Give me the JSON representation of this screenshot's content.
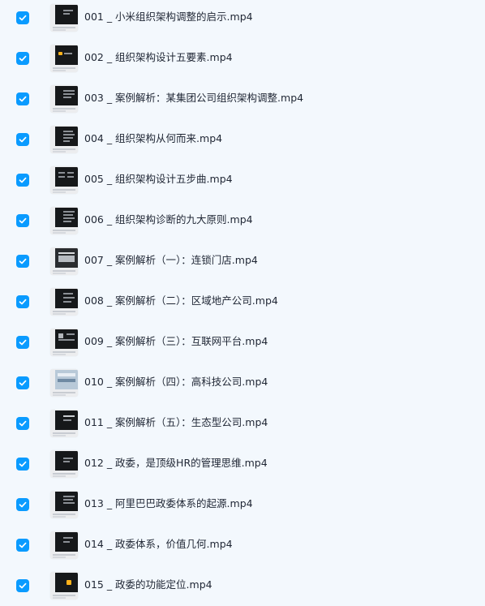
{
  "files": [
    {
      "name": "001 _ 小米组织架构调整的启示.mp4",
      "checked": true
    },
    {
      "name": "002 _ 组织架构设计五要素.mp4",
      "checked": true
    },
    {
      "name": "003 _ 案例解析：某集团公司组织架构调整.mp4",
      "checked": true
    },
    {
      "name": "004 _ 组织架构从何而来.mp4",
      "checked": true
    },
    {
      "name": "005 _ 组织架构设计五步曲.mp4",
      "checked": true
    },
    {
      "name": "006 _ 组织架构诊断的九大原则.mp4",
      "checked": true
    },
    {
      "name": "007 _ 案例解析（一）：连锁门店.mp4",
      "checked": true
    },
    {
      "name": "008 _ 案例解析（二）：区域地产公司.mp4",
      "checked": true
    },
    {
      "name": "009 _ 案例解析（三）：互联网平台.mp4",
      "checked": true
    },
    {
      "name": "010 _ 案例解析（四）：高科技公司.mp4",
      "checked": true
    },
    {
      "name": "011 _ 案例解析（五）：生态型公司.mp4",
      "checked": true
    },
    {
      "name": "012 _ 政委，是顶级HR的管理思维.mp4",
      "checked": true
    },
    {
      "name": "013 _ 阿里巴巴政委体系的起源.mp4",
      "checked": true
    },
    {
      "name": "014 _ 政委体系，价值几何.mp4",
      "checked": true
    },
    {
      "name": "015 _ 政委的功能定位.mp4",
      "checked": true
    }
  ],
  "icons": {
    "checkbox": "checkbox-checked-icon",
    "thumbnail": "video-thumbnail-icon"
  },
  "colors": {
    "background": "#f3f8fd",
    "checkbox": "#0a9bff",
    "text": "#1f2634",
    "thumbnail_screen": "#16181a",
    "thumbnail_accent": "#ffb21a"
  }
}
